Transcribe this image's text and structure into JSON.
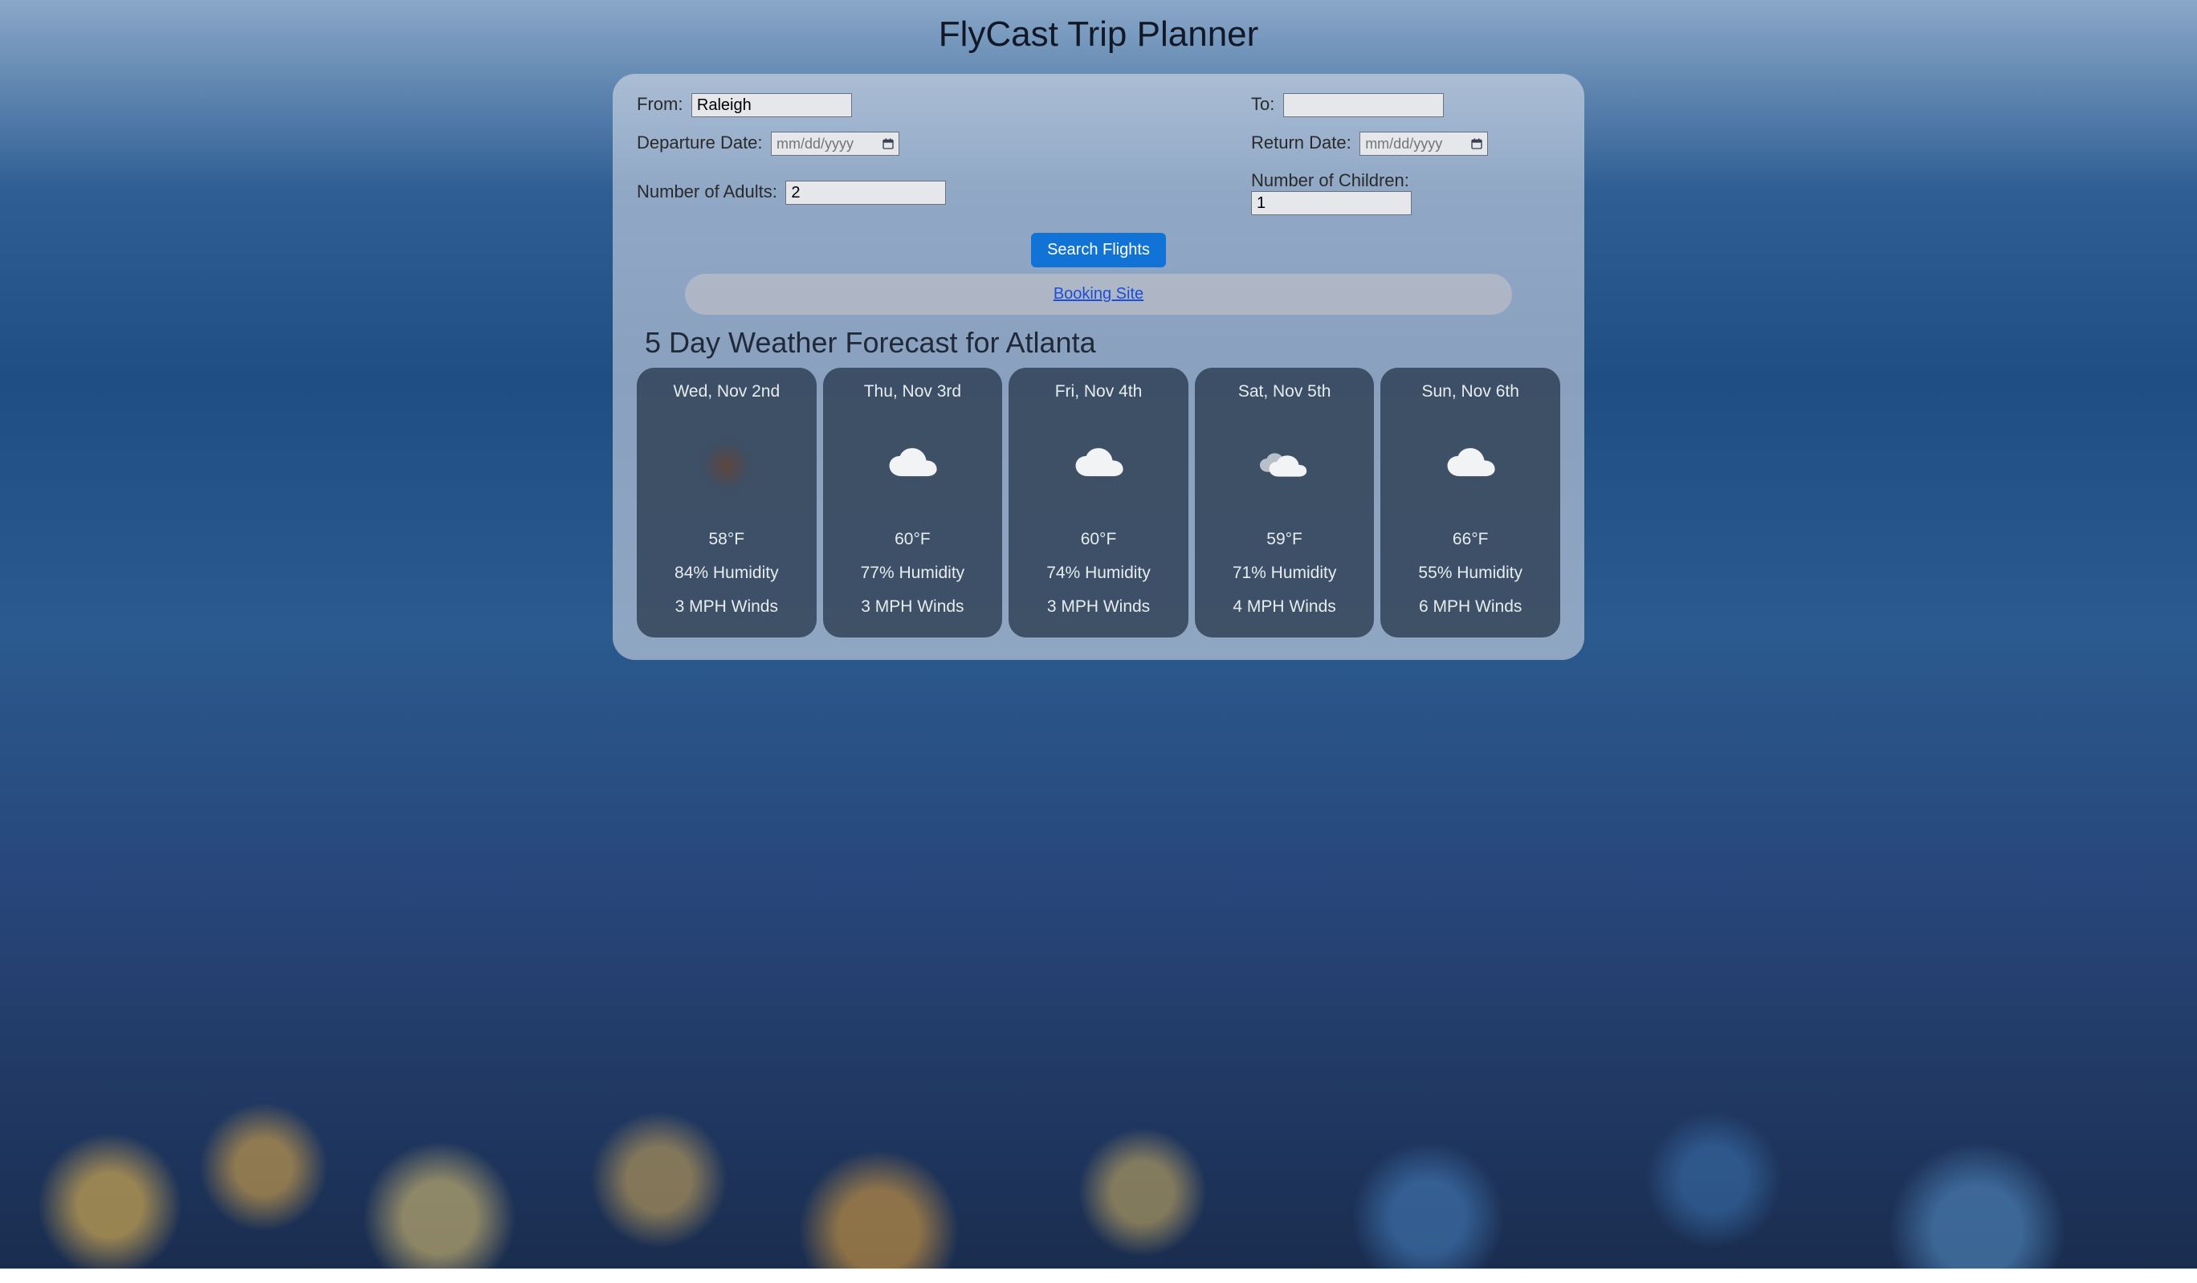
{
  "title": "FlyCast Trip Planner",
  "form": {
    "from_label": "From:",
    "from_value": "Raleigh",
    "to_label": "To:",
    "to_value": "",
    "depart_label": "Departure Date:",
    "depart_placeholder": "mm/dd/yyyy",
    "return_label": "Return Date:",
    "return_placeholder": "mm/dd/yyyy",
    "adults_label": "Number of Adults:",
    "adults_value": "2",
    "children_label": "Number of Children:",
    "children_value": "1",
    "search_button": "Search Flights",
    "booking_link": "Booking Site"
  },
  "forecast": {
    "heading": "5 Day Weather Forecast for Atlanta",
    "days": [
      {
        "date": "Wed, Nov 2nd",
        "icon": "sun-haze",
        "temp": "58°F",
        "humidity": "84% Humidity",
        "wind": "3 MPH Winds"
      },
      {
        "date": "Thu, Nov 3rd",
        "icon": "cloud",
        "temp": "60°F",
        "humidity": "77% Humidity",
        "wind": "3 MPH Winds"
      },
      {
        "date": "Fri, Nov 4th",
        "icon": "cloud",
        "temp": "60°F",
        "humidity": "74% Humidity",
        "wind": "3 MPH Winds"
      },
      {
        "date": "Sat, Nov 5th",
        "icon": "clouds",
        "temp": "59°F",
        "humidity": "71% Humidity",
        "wind": "4 MPH Winds"
      },
      {
        "date": "Sun, Nov 6th",
        "icon": "cloud",
        "temp": "66°F",
        "humidity": "55% Humidity",
        "wind": "6 MPH Winds"
      }
    ]
  }
}
